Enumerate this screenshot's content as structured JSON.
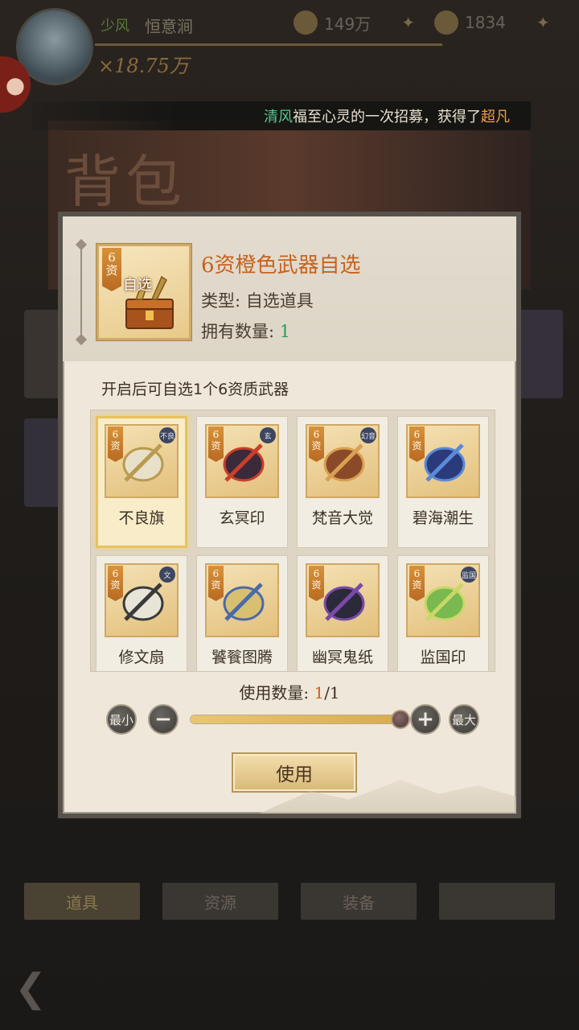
{
  "hud": {
    "vip_label": "少风",
    "player_name": "恒意涧",
    "power": "×18.75万",
    "silver": "149万",
    "gold": "1834"
  },
  "background": {
    "banner_title": "背包",
    "tabs": [
      {
        "label": "道具"
      },
      {
        "label": "资源"
      },
      {
        "label": "装备"
      },
      {
        "label": ""
      }
    ]
  },
  "marquee": {
    "name": "清风",
    "middle": "福至心灵的一次招募，获得了",
    "highlight": "超凡"
  },
  "dialog": {
    "item": {
      "rank": "6资",
      "art_label": "自选",
      "title": "6资橙色武器自选",
      "type_label": "类型: ",
      "type_value": "自选道具",
      "owned_label": "拥有数量: ",
      "owned_value": "1"
    },
    "description": "开启后可自选1个6资质武器",
    "choices": [
      {
        "name": "不良旗",
        "rank": "6资",
        "badge": "不良",
        "selected": true
      },
      {
        "name": "玄冥印",
        "rank": "6资",
        "badge": "玄",
        "selected": false
      },
      {
        "name": "梵音大觉",
        "rank": "6资",
        "badge": "幻音",
        "selected": false
      },
      {
        "name": "碧海潮生",
        "rank": "6资",
        "badge": "",
        "selected": false
      },
      {
        "name": "修文扇",
        "rank": "6资",
        "badge": "文",
        "selected": false
      },
      {
        "name": "饕餮图腾",
        "rank": "6资",
        "badge": "",
        "selected": false
      },
      {
        "name": "幽冥鬼纸",
        "rank": "6资",
        "badge": "",
        "selected": false
      },
      {
        "name": "监国印",
        "rank": "6资",
        "badge": "监国",
        "selected": false
      }
    ],
    "quantity": {
      "label": "使用数量: ",
      "current": "1",
      "total": "/1",
      "fraction": 1.0,
      "min_label": "最小",
      "max_label": "最大",
      "minus_symbol": "−",
      "plus_symbol": "+"
    },
    "use_button": "使用"
  }
}
